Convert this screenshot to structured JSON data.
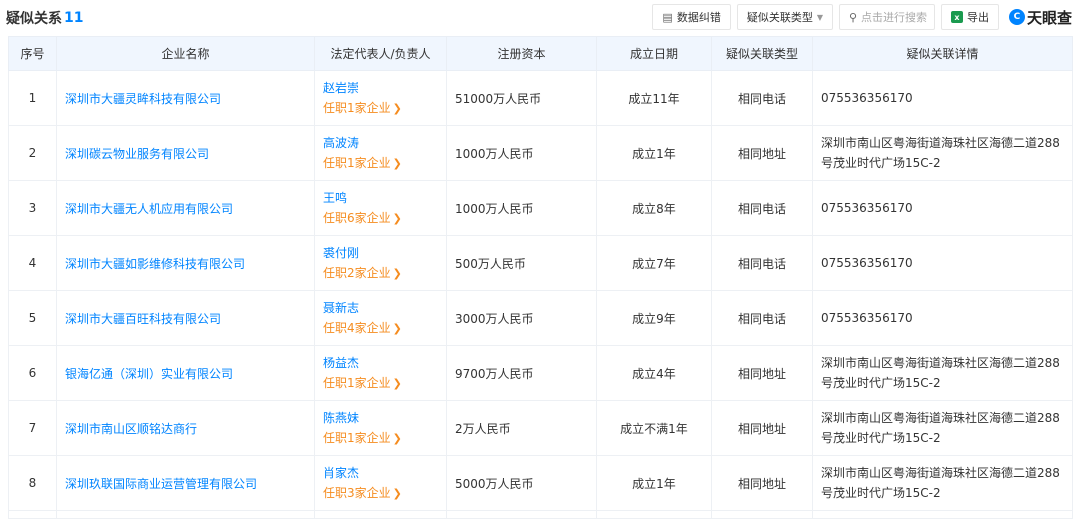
{
  "header": {
    "title": "疑似关系",
    "count": "11",
    "buttons": {
      "correction": "数据纠错",
      "relation_type": "疑似关联类型",
      "search_placeholder": "点击进行搜索",
      "export": "导出"
    },
    "logo": "天眼查"
  },
  "columns": [
    "序号",
    "企业名称",
    "法定代表人/负责人",
    "注册资本",
    "成立日期",
    "疑似关联类型",
    "疑似关联详情"
  ],
  "rows": [
    {
      "index": "1",
      "company": "深圳市大疆灵眸科技有限公司",
      "rep": "赵岩崇",
      "jobs": "任职1家企业",
      "capital": "51000万人民币",
      "founded": "成立11年",
      "type": "相同电话",
      "detail": "075536356170"
    },
    {
      "index": "2",
      "company": "深圳碳云物业服务有限公司",
      "rep": "高波涛",
      "jobs": "任职1家企业",
      "capital": "1000万人民币",
      "founded": "成立1年",
      "type": "相同地址",
      "detail": "深圳市南山区粤海街道海珠社区海德二道288号茂业时代广场15C-2"
    },
    {
      "index": "3",
      "company": "深圳市大疆无人机应用有限公司",
      "rep": "王鸣",
      "jobs": "任职6家企业",
      "capital": "1000万人民币",
      "founded": "成立8年",
      "type": "相同电话",
      "detail": "075536356170"
    },
    {
      "index": "4",
      "company": "深圳市大疆如影维修科技有限公司",
      "rep": "裘付刚",
      "jobs": "任职2家企业",
      "capital": "500万人民币",
      "founded": "成立7年",
      "type": "相同电话",
      "detail": "075536356170"
    },
    {
      "index": "5",
      "company": "深圳市大疆百旺科技有限公司",
      "rep": "聂新志",
      "jobs": "任职4家企业",
      "capital": "3000万人民币",
      "founded": "成立9年",
      "type": "相同电话",
      "detail": "075536356170"
    },
    {
      "index": "6",
      "company": "银海亿通（深圳）实业有限公司",
      "rep": "杨益杰",
      "jobs": "任职1家企业",
      "capital": "9700万人民币",
      "founded": "成立4年",
      "type": "相同地址",
      "detail": "深圳市南山区粤海街道海珠社区海德二道288号茂业时代广场15C-2"
    },
    {
      "index": "7",
      "company": "深圳市南山区顺铭达商行",
      "rep": "陈燕妹",
      "jobs": "任职1家企业",
      "capital": "2万人民币",
      "founded": "成立不满1年",
      "type": "相同地址",
      "detail": "深圳市南山区粤海街道海珠社区海德二道288号茂业时代广场15C-2"
    },
    {
      "index": "8",
      "company": "深圳玖联国际商业运营管理有限公司",
      "rep": "肖家杰",
      "jobs": "任职3家企业",
      "capital": "5000万人民币",
      "founded": "成立1年",
      "type": "相同地址",
      "detail": "深圳市南山区粤海街道海珠社区海德二道288号茂业时代广场15C-2"
    }
  ]
}
